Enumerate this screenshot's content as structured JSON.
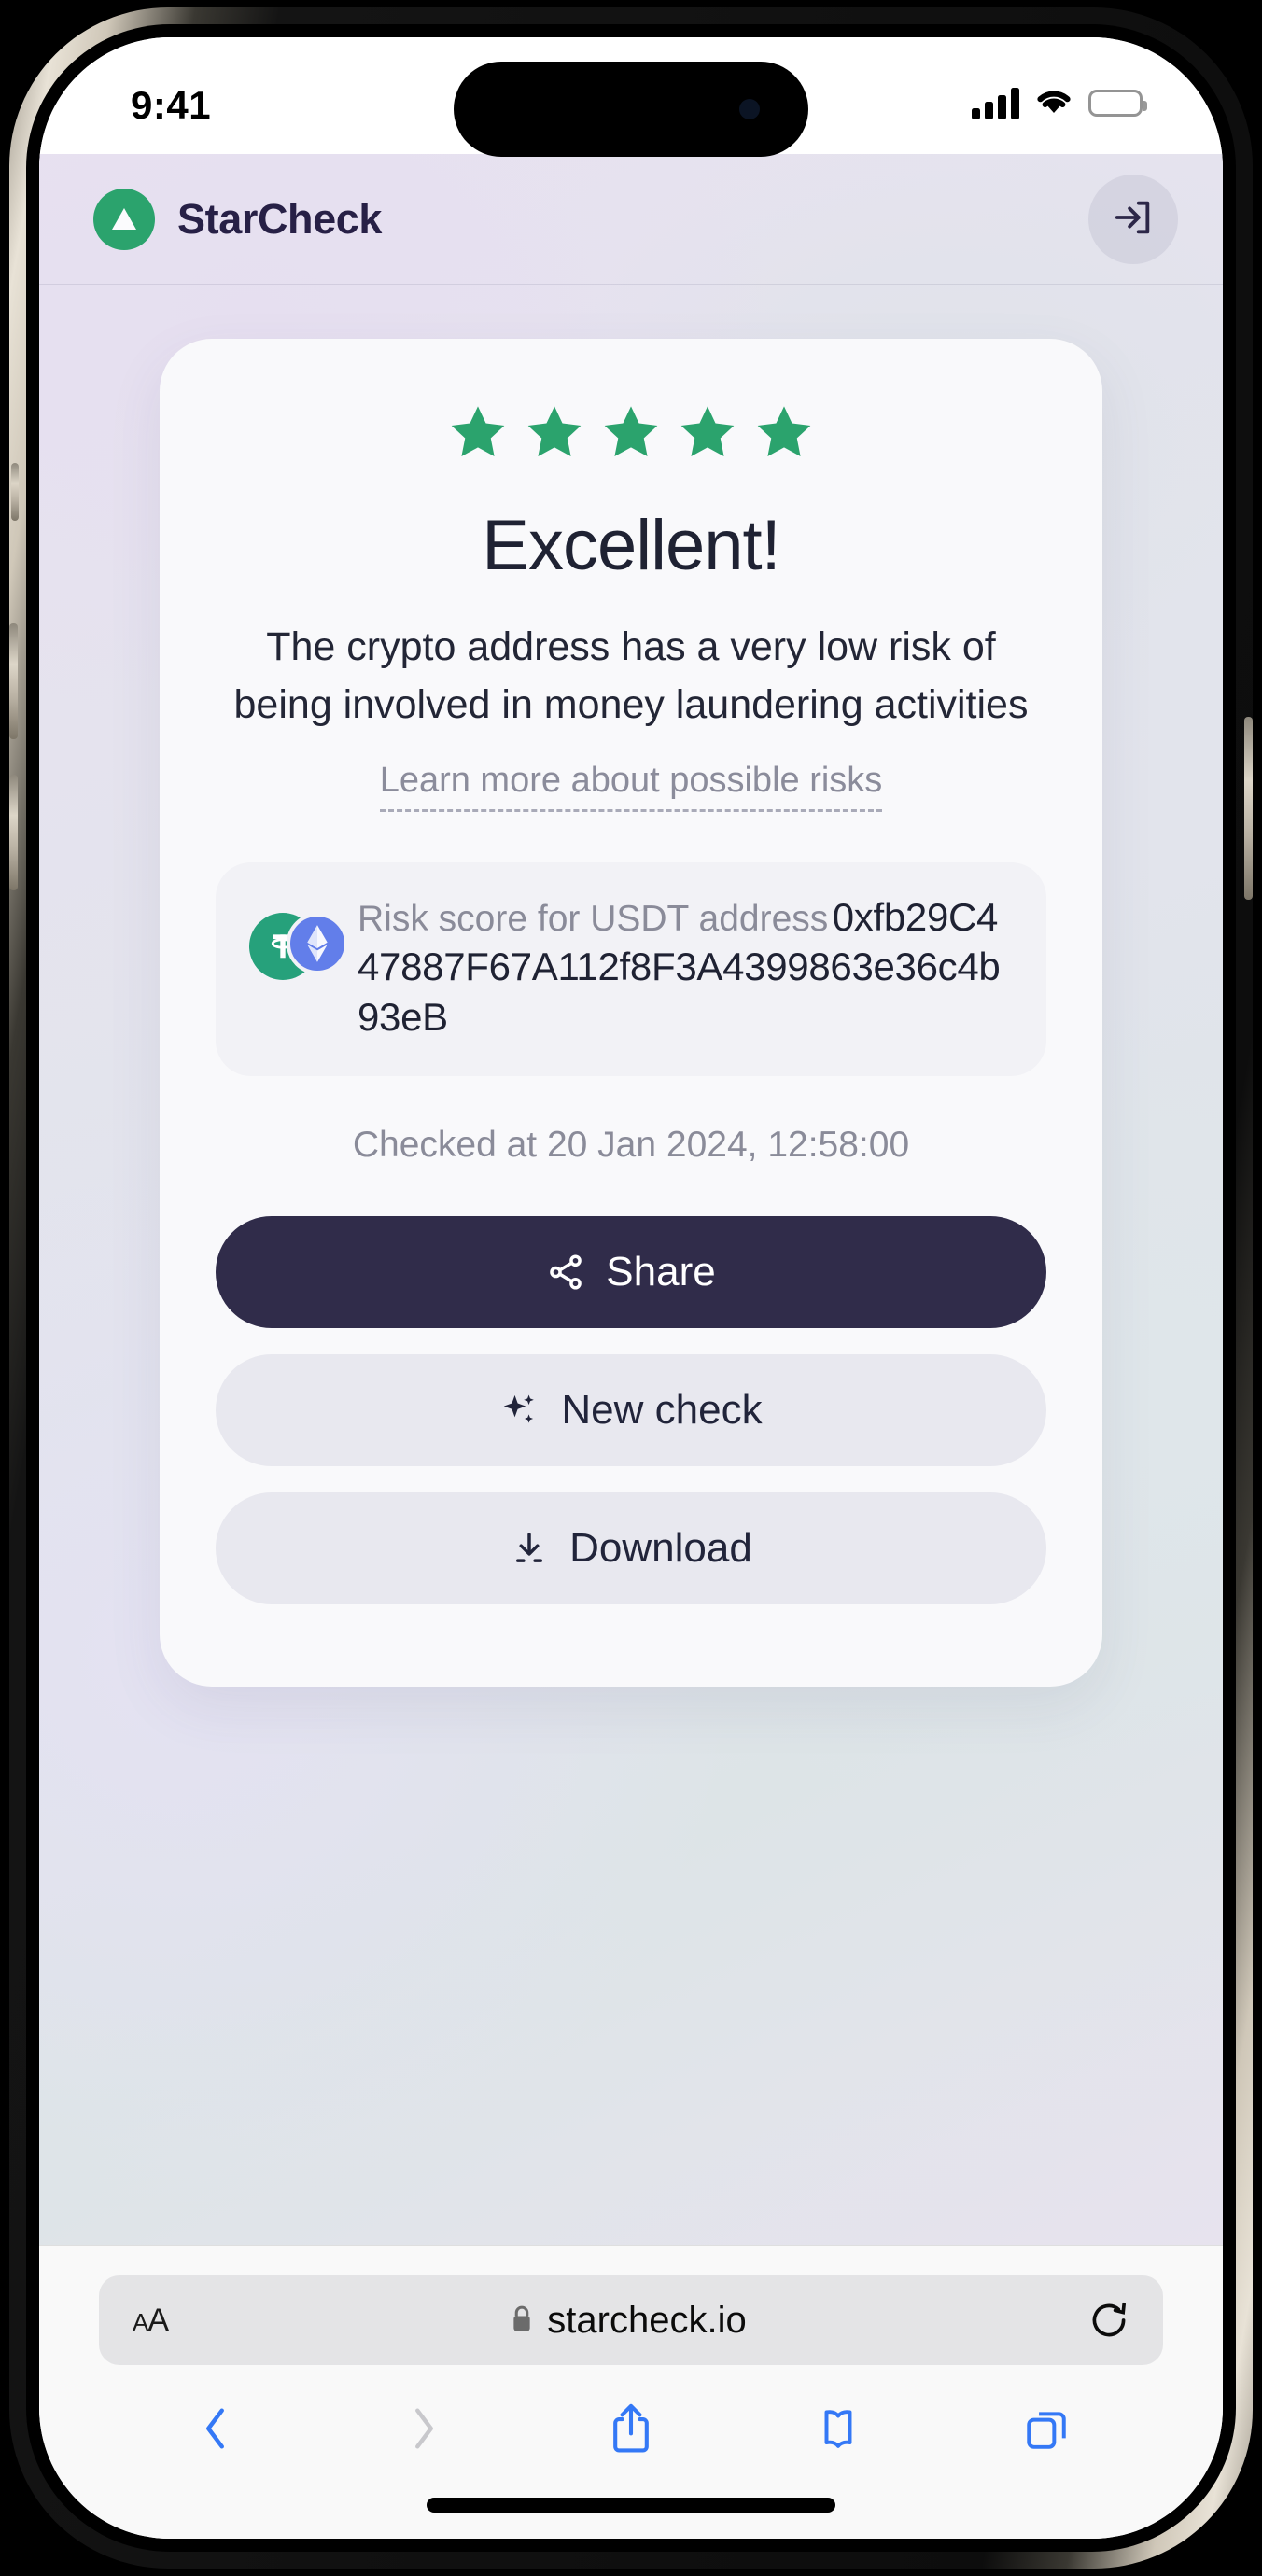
{
  "status_bar": {
    "time": "9:41",
    "signal_icon": "cellular-signal-icon",
    "wifi_icon": "wifi-icon",
    "battery_icon": "battery-icon"
  },
  "app_header": {
    "brand_name": "StarCheck",
    "logo_icon": "starcheck-triangle-logo",
    "login_icon": "login-arrow-icon",
    "brand_color": "#2ba36d",
    "brand_text_color": "#272046"
  },
  "result": {
    "star_count": 5,
    "star_color": "#2ba36d",
    "verdict": "Excellent!",
    "description": "The crypto address has a very low risk of being involved in money laundering activities",
    "learn_more_label": "Learn more about possible risks",
    "address_label": "Risk score for USDT address",
    "address_value": "0xfb29C447887F67A112f8F3A4399863e36c4b93eB",
    "usdt_icon": "usdt-tether-icon",
    "eth_icon": "ethereum-network-icon",
    "usdt_color": "#26a17b",
    "eth_color": "#627eea",
    "checked_at": "Checked at 20 Jan 2024, 12:58:00"
  },
  "actions": {
    "share_label": "Share",
    "share_icon": "share-nodes-icon",
    "new_check_label": "New check",
    "new_check_icon": "sparkles-icon",
    "download_label": "Download",
    "download_icon": "download-arrow-icon",
    "share_bg": "#302c4a"
  },
  "safari": {
    "text_size_big": "A",
    "text_size_small": "A",
    "lock_icon": "lock-icon",
    "url": "starcheck.io",
    "reload_icon": "reload-icon",
    "back_icon": "chevron-left-icon",
    "forward_icon": "chevron-right-icon",
    "share_icon": "share-up-arrow-icon",
    "bookmarks_icon": "book-icon",
    "tabs_icon": "tabs-icon",
    "accent_color": "#3478f6"
  }
}
